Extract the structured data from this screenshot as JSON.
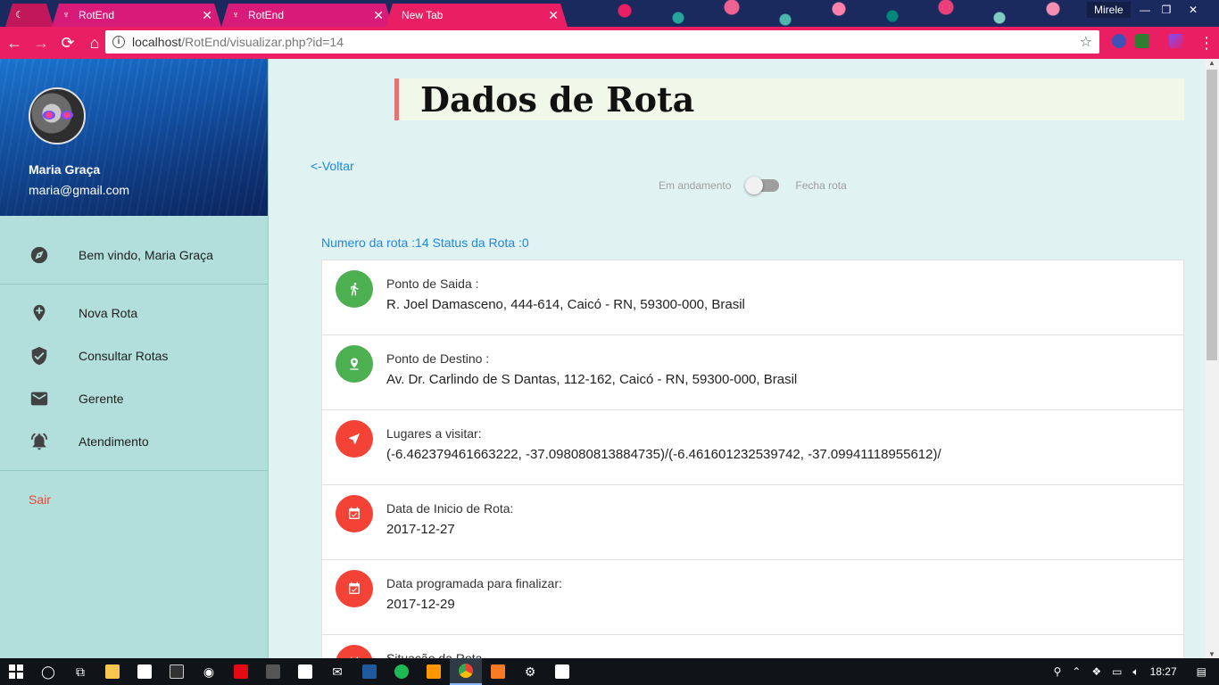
{
  "browser": {
    "tabs": [
      {
        "label": ""
      },
      {
        "label": "RotEnd"
      },
      {
        "label": "RotEnd"
      },
      {
        "label": "New Tab"
      }
    ],
    "profile": "Mirele",
    "url_host": "localhost",
    "url_path": "/RotEnd/visualizar.php?id=14"
  },
  "sidebar": {
    "user_name": "Maria Graça",
    "user_email": "maria@gmail.com",
    "welcome": "Bem vindo, Maria Graça",
    "items": [
      {
        "label": "Nova Rota",
        "icon": "add-location-icon"
      },
      {
        "label": "Consultar Rotas",
        "icon": "verified-check-icon"
      },
      {
        "label": "Gerente",
        "icon": "mail-icon"
      },
      {
        "label": "Atendimento",
        "icon": "alarm-bell-icon"
      }
    ],
    "logout": "Sair"
  },
  "main": {
    "title": "Dados de Rota",
    "back": "<-Voltar",
    "switch_off": "Em andamento",
    "switch_on": "Fecha rota",
    "route_info": "Numero da rota :14 Status da Rota :0",
    "details": [
      {
        "label": "Ponto de Saida :",
        "value": "R. Joel Damasceno, 444-614, Caicó - RN, 59300-000, Brasil",
        "icon": "walk-icon",
        "color": "#4caf50"
      },
      {
        "label": "Ponto de Destino :",
        "value": "Av. Dr. Carlindo de S Dantas, 112-162, Caicó - RN, 59300-000, Brasil",
        "icon": "pin-icon",
        "color": "#4caf50"
      },
      {
        "label": "Lugares a visitar:",
        "value": "(-6.462379461663222, -37.098080813884735)/(-6.461601232539742, -37.09941118955612)/",
        "icon": "navigation-icon",
        "color": "#f44336"
      },
      {
        "label": "Data de Inicio de Rota:",
        "value": "2017-12-27",
        "icon": "calendar-icon",
        "color": "#f44336"
      },
      {
        "label": "Data programada para finalizar:",
        "value": "2017-12-29",
        "icon": "calendar-icon",
        "color": "#f44336"
      },
      {
        "label": "Situação da Rota",
        "value": "",
        "icon": "calendar-icon",
        "color": "#f44336"
      }
    ]
  },
  "taskbar": {
    "time": "18:27"
  }
}
